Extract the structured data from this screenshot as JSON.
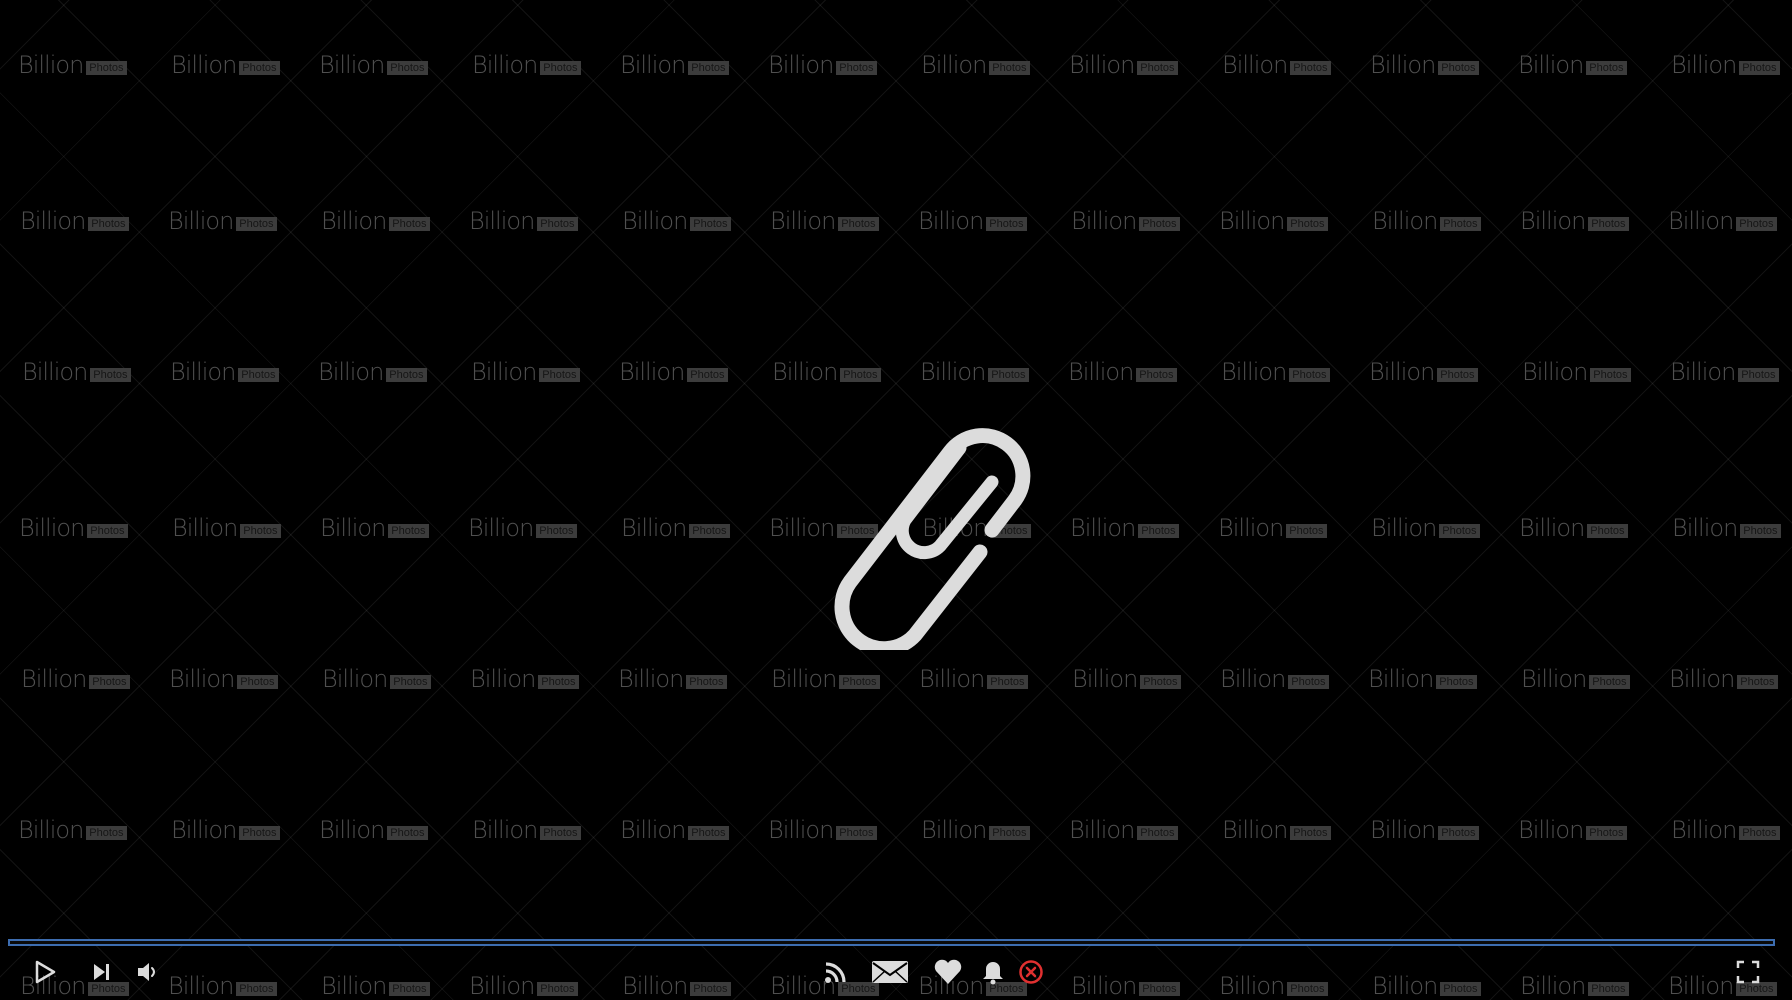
{
  "watermark": {
    "brand": "Billion",
    "badge": "Photos"
  },
  "media": {
    "subject_icon": "paperclip-icon",
    "progress": 0
  },
  "controls": {
    "left": [
      "play-icon",
      "skip-next-icon",
      "volume-icon"
    ],
    "center": [
      "rss-icon",
      "envelope-icon",
      "heart-icon",
      "bell-icon",
      "close-circle-icon"
    ],
    "right": [
      "fullscreen-icon"
    ]
  },
  "colors": {
    "background": "#000000",
    "icon": "#dcdcdc",
    "progress_border": "#3d6db0",
    "close_icon": "#e03030"
  }
}
